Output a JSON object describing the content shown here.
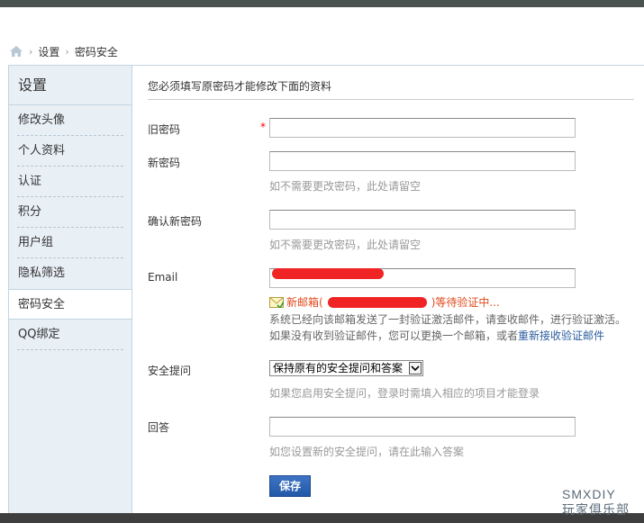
{
  "breadcrumb": {
    "items": [
      "设置",
      "密码安全"
    ]
  },
  "sidebar": {
    "title": "设置",
    "items": [
      {
        "label": "修改头像"
      },
      {
        "label": "个人资料"
      },
      {
        "label": "认证"
      },
      {
        "label": "积分"
      },
      {
        "label": "用户组"
      },
      {
        "label": "隐私筛选"
      },
      {
        "label": "密码安全"
      },
      {
        "label": "QQ绑定"
      }
    ],
    "active": "密码安全"
  },
  "form": {
    "notice": "您必须填写原密码才能修改下面的资料",
    "old_password": {
      "label": "旧密码",
      "required": "*",
      "value": ""
    },
    "new_password": {
      "label": "新密码",
      "value": "",
      "hint": "如不需要更改密码，此处请留空"
    },
    "confirm_password": {
      "label": "确认新密码",
      "value": "",
      "hint": "如不需要更改密码，此处请留空"
    },
    "email": {
      "label": "Email",
      "status_prefix": "新邮箱(",
      "status_suffix": ")等待验证中...",
      "desc1": "系统已经向该邮箱发送了一封验证激活邮件，请查收邮件，进行验证激活。",
      "desc2": "如果没有收到验证邮件，您可以更换一个邮箱，或者",
      "resend_link": "重新接收验证邮件"
    },
    "security_question": {
      "label": "安全提问",
      "selected": "保持原有的安全提问和答案",
      "hint": "如果您启用安全提问，登录时需填入相应的项目才能登录"
    },
    "answer": {
      "label": "回答",
      "value": "",
      "hint": "如您设置新的安全提问，请在此输入答案"
    },
    "save_label": "保存"
  },
  "watermark": {
    "line1": "SMXDIY",
    "line2": "玩家俱乐部"
  },
  "colors": {
    "accent": "#2158a8",
    "sidebar_bg": "#e8eff5",
    "warning": "#e04a1c",
    "redaction": "#f02424"
  },
  "icons": {
    "home": "home-icon",
    "mail": "mail-icon",
    "dropdown": "chevron-down-icon"
  }
}
